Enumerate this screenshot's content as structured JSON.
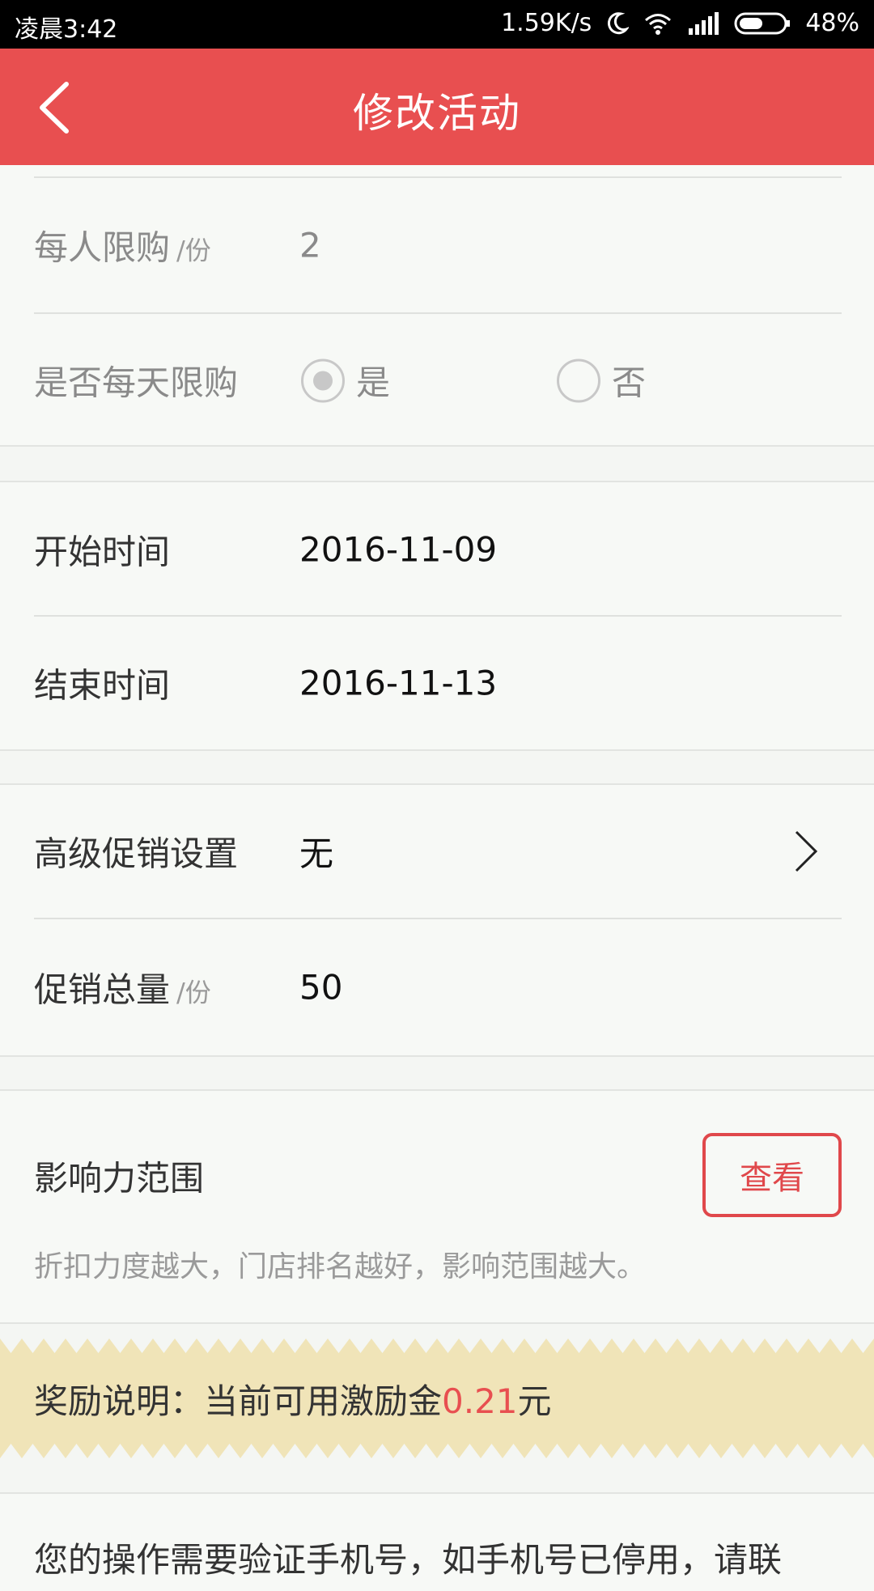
{
  "status_bar": {
    "time": "凌晨3:42",
    "speed": "1.59K/s",
    "battery": "48%",
    "icons": [
      "moon-icon",
      "wifi-icon",
      "signal-icon",
      "battery-icon"
    ]
  },
  "header": {
    "title": "修改活动",
    "back_icon": "chevron-left-icon"
  },
  "limits": {
    "per_person_label": "每人限购",
    "per_person_unit": "/份",
    "per_person_value": "2",
    "daily_limit_label": "是否每天限购",
    "yes_label": "是",
    "no_label": "否",
    "daily_limit_selected": "是"
  },
  "dates": {
    "start_label": "开始时间",
    "start_value": "2016-11-09",
    "end_label": "结束时间",
    "end_value": "2016-11-13"
  },
  "promo": {
    "advanced_label": "高级促销设置",
    "advanced_value": "无",
    "total_label": "促销总量",
    "total_unit": "/份",
    "total_value": "50"
  },
  "influence": {
    "label": "影响力范围",
    "button_label": "查看",
    "hint": "折扣力度越大，门店排名越好，影响范围越大。"
  },
  "reward": {
    "prefix": "奖励说明：当前可用激励金",
    "amount": "0.21",
    "suffix": "元"
  },
  "footer_notice": {
    "text": "您的操作需要验证手机号，如手机号已停用，请联"
  },
  "colors": {
    "accent": "#e84f50",
    "reward_bg": "#f0e4b8",
    "page_bg": "#f4f6f3"
  }
}
